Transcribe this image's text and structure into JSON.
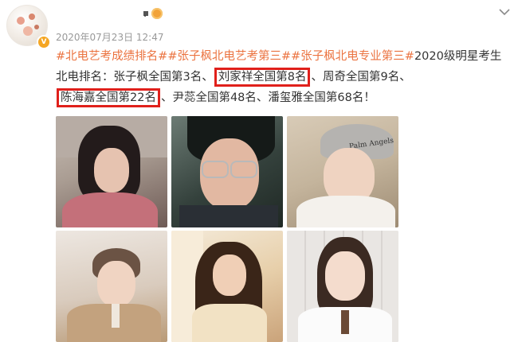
{
  "post": {
    "author": {
      "name": "·",
      "avatar_icon": "avatar-image",
      "verified_icon": "verified-v-icon",
      "vip_icon": "vip-badge-icon"
    },
    "date_time": "2020年07月23日 12:47",
    "more_icon": "chevron-down-icon",
    "content": {
      "tags": [
        "#北电艺考成绩排名#",
        "#张子枫北电艺考第三#",
        "#张子枫北电专业第三#"
      ],
      "segments": [
        "2020级明星考生北电排名：张子枫全国第3名、",
        "刘家祥全国第8名",
        "、周奇全国第9名、",
        "陈海嘉全国第22名",
        "、尹蕊全国第48名、潘玺雅全国第68名！"
      ],
      "highlight_color": "#e0201b",
      "tag_color": "#eb7340"
    },
    "photo_caption": "Palm Angels"
  }
}
